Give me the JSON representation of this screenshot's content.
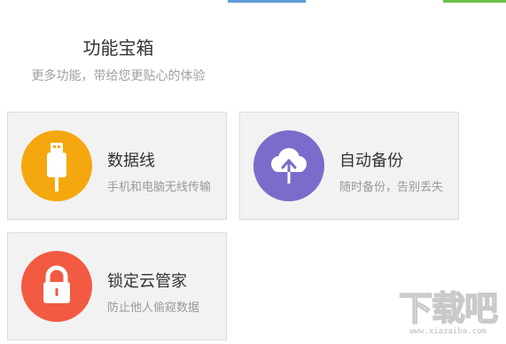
{
  "header": {
    "title": "功能宝箱",
    "subtitle": "更多功能，带给您更贴心的体验"
  },
  "features": [
    {
      "title": "数据线",
      "desc": "手机和电脑无线传输",
      "icon": "usb-cable-icon",
      "color": "#f5a70f"
    },
    {
      "title": "自动备份",
      "desc": "随时备份，告别丢失",
      "icon": "cloud-upload-icon",
      "color": "#7b6ccb"
    },
    {
      "title": "锁定云管家",
      "desc": "防止他人偷窥数据",
      "icon": "padlock-icon",
      "color": "#f25a42"
    }
  ],
  "watermark": {
    "text": "下载吧",
    "sub": "www.xiazaiba.com"
  },
  "colors": {
    "card_bg": "#f2f2f2",
    "top_accent_blue": "#5b9bd5",
    "top_accent_green": "#6cc04a"
  }
}
